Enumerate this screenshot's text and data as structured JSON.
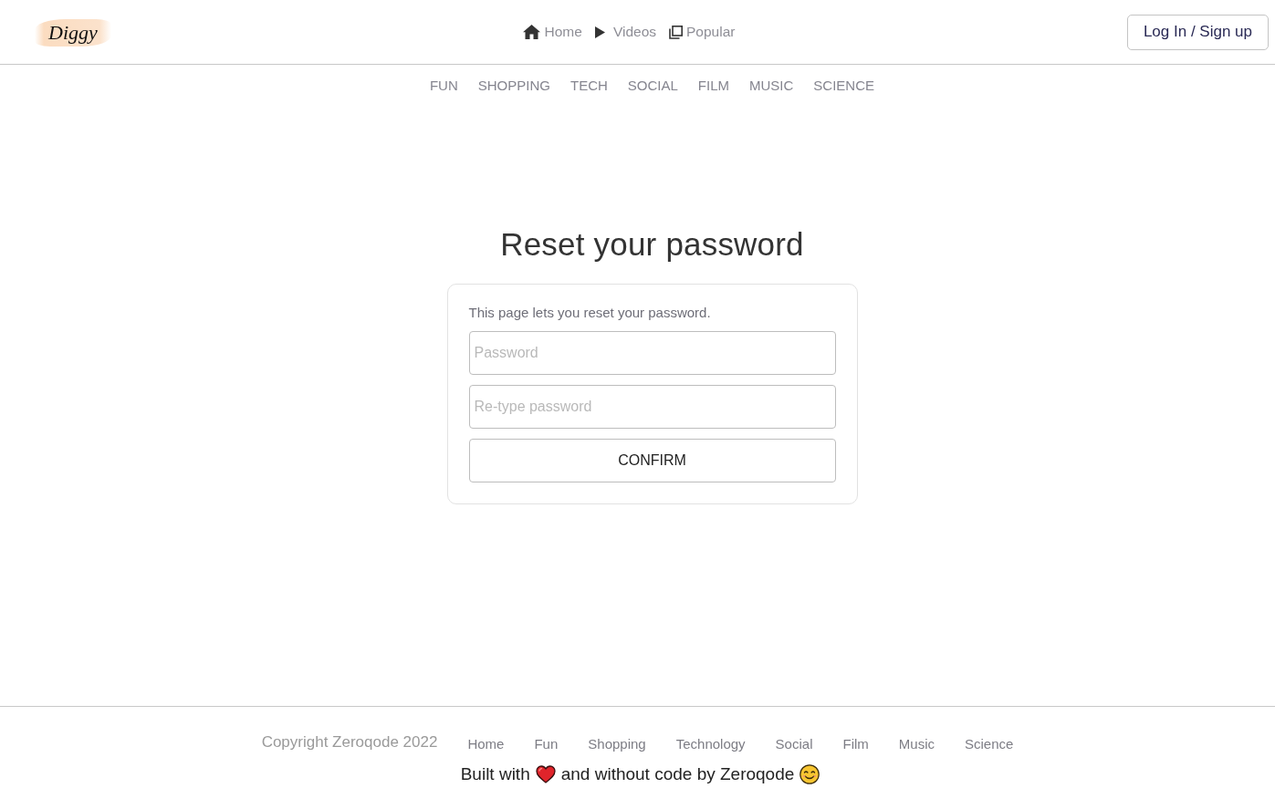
{
  "header": {
    "logo": "Diggy",
    "nav": [
      {
        "kind": "home",
        "label": "Home"
      },
      {
        "kind": "play",
        "label": "Videos"
      },
      {
        "kind": "copy",
        "label": "Popular"
      }
    ],
    "login_button": "Log In / Sign up"
  },
  "categories": [
    "FUN",
    "SHOPPING",
    "TECH",
    "SOCIAL",
    "FILM",
    "MUSIC",
    "SCIENCE"
  ],
  "main": {
    "title": "Reset your password",
    "card": {
      "description": "This page lets you reset your password.",
      "fields": [
        {
          "placeholder": "Password"
        },
        {
          "placeholder": "Re-type password"
        }
      ],
      "button": "CONFIRM"
    }
  },
  "footer": {
    "copyright": "Copyright Zeroqode 2022",
    "links": [
      "Home",
      "Fun",
      "Shopping",
      "Technology",
      "Social",
      "Film",
      "Music",
      "Science"
    ],
    "credit": [
      "Built with",
      "and without code by Zeroqode"
    ]
  }
}
